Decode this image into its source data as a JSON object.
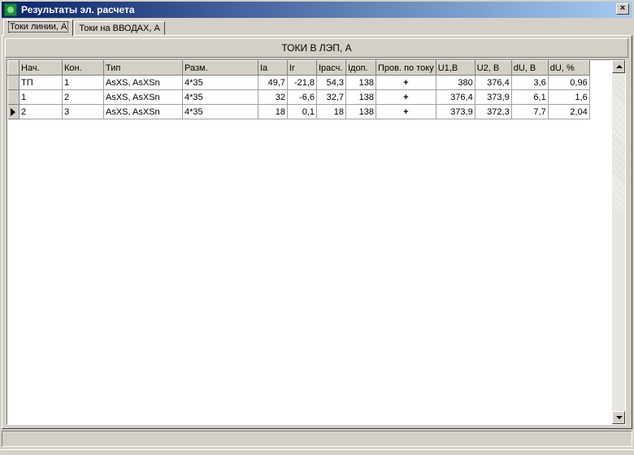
{
  "window": {
    "title": "Результаты эл. расчета",
    "close_label": "×"
  },
  "tabs": [
    {
      "label": "Токи линии, А",
      "active": true
    },
    {
      "label": "Токи на ВВОДАХ, А",
      "active": false
    }
  ],
  "grid": {
    "caption": "ТОКИ В ЛЭП, А",
    "columns": [
      "Нач.",
      "Кон.",
      "Тип",
      "Разм.",
      "Ia",
      "Ir",
      "Iрасч.",
      "Iдоп.",
      "Пров. по току",
      "U1,В",
      "U2, В",
      "dU, В",
      "dU, %"
    ],
    "rows": [
      {
        "cells": [
          "ТП",
          "1",
          "AsXS, AsXSn",
          "4*35",
          "49,7",
          "-21,8",
          "54,3",
          "138",
          "+",
          "380",
          "376,4",
          "3,6",
          "0,96"
        ],
        "current": false
      },
      {
        "cells": [
          "1",
          "2",
          "AsXS, AsXSn",
          "4*35",
          "32",
          "-6,6",
          "32,7",
          "138",
          "+",
          "376,4",
          "373,9",
          "6,1",
          "1,6"
        ],
        "current": false
      },
      {
        "cells": [
          "2",
          "3",
          "AsXS, AsXSn",
          "4*35",
          "18",
          "0,1",
          "18",
          "138",
          "+",
          "373,9",
          "372,3",
          "7,7",
          "2,04"
        ],
        "current": true
      }
    ]
  },
  "colors": {
    "title_start": "#0a246a",
    "title_end": "#a6caf0",
    "face": "#d4d0c8"
  }
}
